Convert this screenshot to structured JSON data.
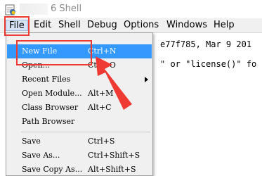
{
  "window": {
    "title_fragment": "6 Shell"
  },
  "menubar": {
    "items": [
      "File",
      "Edit",
      "Shell",
      "Debug",
      "Options",
      "Windows",
      "Help"
    ]
  },
  "editor": {
    "line1": "e77f785, Mar  9 201",
    "line2": "\" or \"license()\" fo"
  },
  "file_menu": {
    "items": [
      {
        "label": "New File",
        "accel": "Ctrl+N"
      },
      {
        "label": "Open...",
        "accel": "Ctrl+O"
      },
      {
        "label": "Recent Files",
        "accel": ""
      },
      {
        "label": "Open Module...",
        "accel": "Alt+M"
      },
      {
        "label": "Class Browser",
        "accel": "Alt+C"
      },
      {
        "label": "Path Browser",
        "accel": ""
      },
      {
        "label": "Save",
        "accel": "Ctrl+S"
      },
      {
        "label": "Save As...",
        "accel": "Ctrl+Shift+S"
      },
      {
        "label": "Save Copy As...",
        "accel": "Alt+Shift+S"
      }
    ]
  },
  "colors": {
    "highlight": "#3399ff",
    "annotation": "#ee3a33",
    "menu_bg": "#f0f0f0"
  },
  "icons": {
    "app": "python-idle-icon",
    "submenu": "submenu-arrow-icon"
  }
}
